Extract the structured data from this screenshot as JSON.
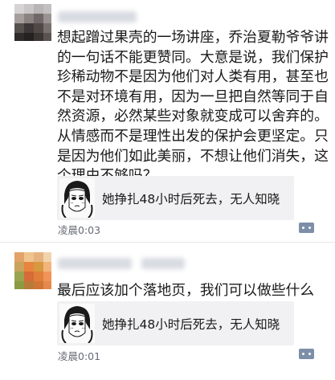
{
  "posts": [
    {
      "text": "想起蹭过果壳的一场讲座，乔治夏勒爷爷讲的一句话不能更赞同。大意是说，我们保护珍稀动物不是因为他们对人类有用，甚至也不是对环境有用，因为一旦把自然等同于自然资源，必然某些对象就变成可以舍弃的。从情感而不是理性出发的保护会更坚定。只是因为他们如此美丽，不想让他们消失，这个理由不够吗？",
      "link_card": {
        "title": "她挣扎48小时后死去，无人知晓"
      },
      "time": "凌晨0:03",
      "comment_icon": "comment-icon"
    },
    {
      "text": "最后应该加个落地页，我们可以做些什么",
      "link_card": {
        "title": "她挣扎48小时后死去，无人知晓"
      },
      "time": "凌晨0:01",
      "comment_icon": "comment-icon"
    }
  ],
  "colors": {
    "background": "#ffffff",
    "text": "#1a1a1a",
    "time": "#666a73",
    "card_bg": "#f1f1f3",
    "comment_icon": "#7d8fa8"
  }
}
